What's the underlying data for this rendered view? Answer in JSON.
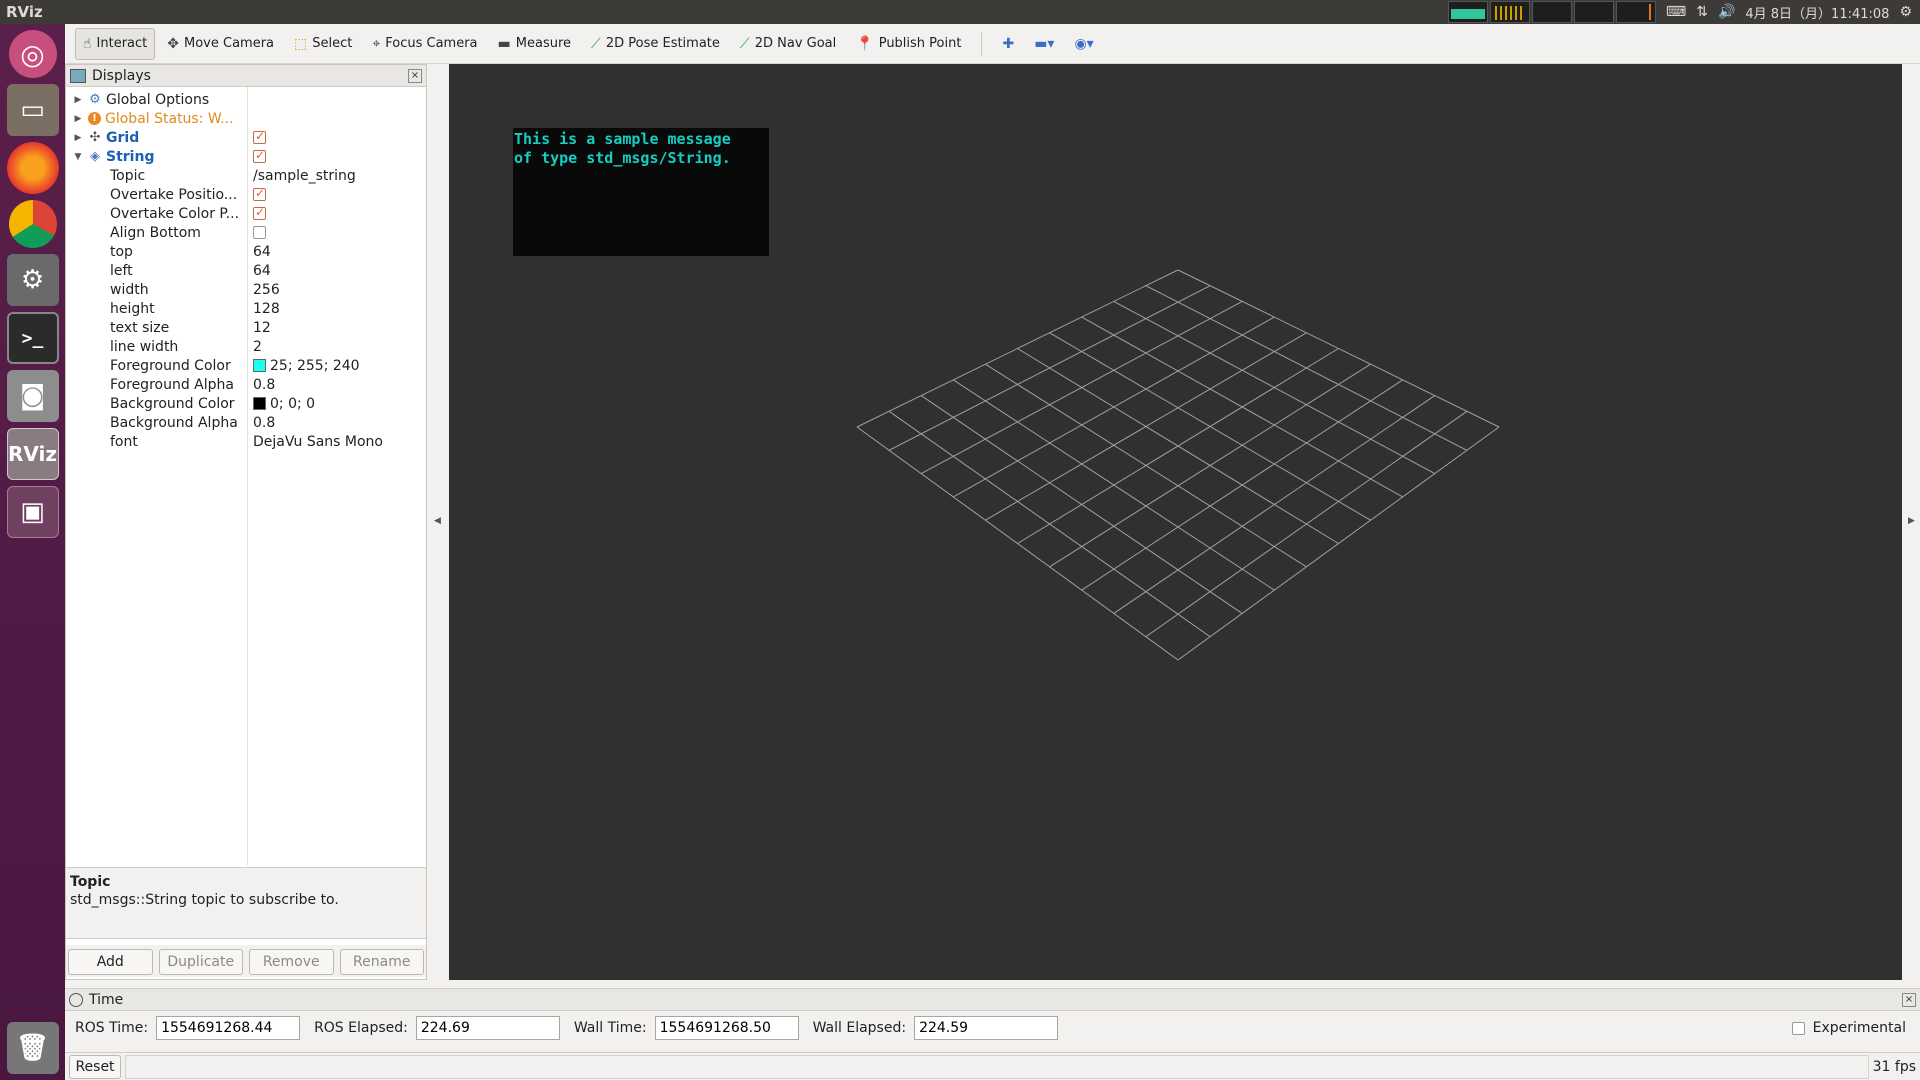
{
  "topbar": {
    "app_title": "RViz",
    "clock": "4月 8日（月）11:41:08",
    "icons": [
      "keyboard-icon",
      "network-icon",
      "volume-icon",
      "power-gear-icon"
    ]
  },
  "launcher": {
    "items": [
      "ubuntu-icon",
      "files-icon",
      "firefox-icon",
      "chrome-icon",
      "settings-icon",
      "terminal-icon",
      "camera-icon",
      "rviz-icon",
      "workspaces-icon",
      "trash-icon"
    ],
    "terminal_glyph": ">_",
    "rviz_label": "RViz"
  },
  "toolbar": {
    "interact": "Interact",
    "move_camera": "Move Camera",
    "select": "Select",
    "focus_camera": "Focus Camera",
    "measure": "Measure",
    "pose_estimate": "2D Pose Estimate",
    "nav_goal": "2D Nav Goal",
    "publish_point": "Publish Point"
  },
  "displays": {
    "title": "Displays",
    "global_options": "Global Options",
    "global_status": "Global Status: W...",
    "grid": "Grid",
    "grid_enabled": true,
    "string": "String",
    "string_enabled": true,
    "properties": [
      {
        "name": "Topic",
        "value": "/sample_string"
      },
      {
        "name": "Overtake Positio...",
        "check": true
      },
      {
        "name": "Overtake Color P...",
        "check": true
      },
      {
        "name": "Align Bottom",
        "check": false
      },
      {
        "name": "top",
        "value": "64"
      },
      {
        "name": "left",
        "value": "64"
      },
      {
        "name": "width",
        "value": "256"
      },
      {
        "name": "height",
        "value": "128"
      },
      {
        "name": "text size",
        "value": "12"
      },
      {
        "name": "line width",
        "value": "2"
      },
      {
        "name": "Foreground Color",
        "value": "25; 255; 240",
        "swatch": "#19fff0"
      },
      {
        "name": "Foreground Alpha",
        "value": "0.8"
      },
      {
        "name": "Background Color",
        "value": "0; 0; 0",
        "swatch": "#000000"
      },
      {
        "name": "Background Alpha",
        "value": "0.8"
      },
      {
        "name": "font",
        "value": "DejaVu Sans Mono"
      }
    ],
    "description_title": "Topic",
    "description_text": "std_msgs::String topic to subscribe to.",
    "buttons": {
      "add": "Add",
      "duplicate": "Duplicate",
      "remove": "Remove",
      "rename": "Rename"
    }
  },
  "view": {
    "overlay_lines": [
      "This is a sample message",
      "of type std_msgs/String."
    ],
    "background": "#303030",
    "grid_color": "#a0a0a0"
  },
  "time": {
    "title": "Time",
    "ros_time_label": "ROS Time:",
    "ros_time": "1554691268.44",
    "ros_elapsed_label": "ROS Elapsed:",
    "ros_elapsed": "224.69",
    "wall_time_label": "Wall Time:",
    "wall_time": "1554691268.50",
    "wall_elapsed_label": "Wall Elapsed:",
    "wall_elapsed": "224.59",
    "experimental_label": "Experimental"
  },
  "bottombar": {
    "reset": "Reset",
    "fps": "31 fps"
  }
}
